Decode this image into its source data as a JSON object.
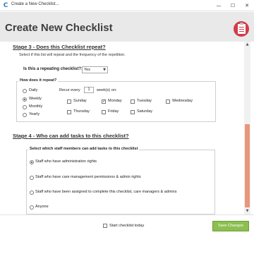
{
  "window": {
    "title": "Create a New Checklist...",
    "app_icon": "C",
    "minimize_icon": "minimize-icon",
    "maximize_icon": "maximize-icon",
    "close_icon": "close-icon",
    "min_glyph": "—",
    "max_glyph": "☐",
    "close_glyph": "✕"
  },
  "header": {
    "title": "Create New Checklist",
    "icon": "clipboard-icon"
  },
  "stage3": {
    "title": "Stage 3 - Does this Checklist repeat?",
    "description": "Select if this list will repeat and the frequency of the repetition.",
    "repeat_label": "Is this a repeating checklist?:",
    "repeat_value": "Yes",
    "how_legend": "How does it repeat?",
    "frequencies": [
      {
        "label": "Daily",
        "checked": false
      },
      {
        "label": "Weekly",
        "checked": true
      },
      {
        "label": "Monthly",
        "checked": false
      },
      {
        "label": "Yearly",
        "checked": false
      }
    ],
    "recur_label": "Recur every",
    "recur_value": "1",
    "recur_suffix": "week(s) on:",
    "days": [
      {
        "label": "Sunday",
        "checked": false
      },
      {
        "label": "Monday",
        "checked": true
      },
      {
        "label": "Tuesday",
        "checked": false
      },
      {
        "label": "Wednesday",
        "checked": false
      },
      {
        "label": "Thursday",
        "checked": false
      },
      {
        "label": "Friday",
        "checked": false
      },
      {
        "label": "Saturday",
        "checked": false
      }
    ]
  },
  "stage4": {
    "title": "Stage 4 - Who can add tasks to this checklist?",
    "legend": "Select which staff members can add tasks to this checklist",
    "options": [
      {
        "label": "Staff who have administration rights",
        "checked": true
      },
      {
        "label": "Staff who have care management permissions & admin rights",
        "checked": false
      },
      {
        "label": "Staff who have been assigned to complete this checklist, care managers & admins",
        "checked": false
      },
      {
        "label": "Anyone",
        "checked": false
      }
    ]
  },
  "footer": {
    "start_today_label": "Start checklist today",
    "start_today_checked": false,
    "save_label": "Save Changes"
  },
  "colors": {
    "accent_green": "#8cbf4f",
    "scroll_thumb": "#e9967a",
    "badge_red": "#d33b4a"
  }
}
